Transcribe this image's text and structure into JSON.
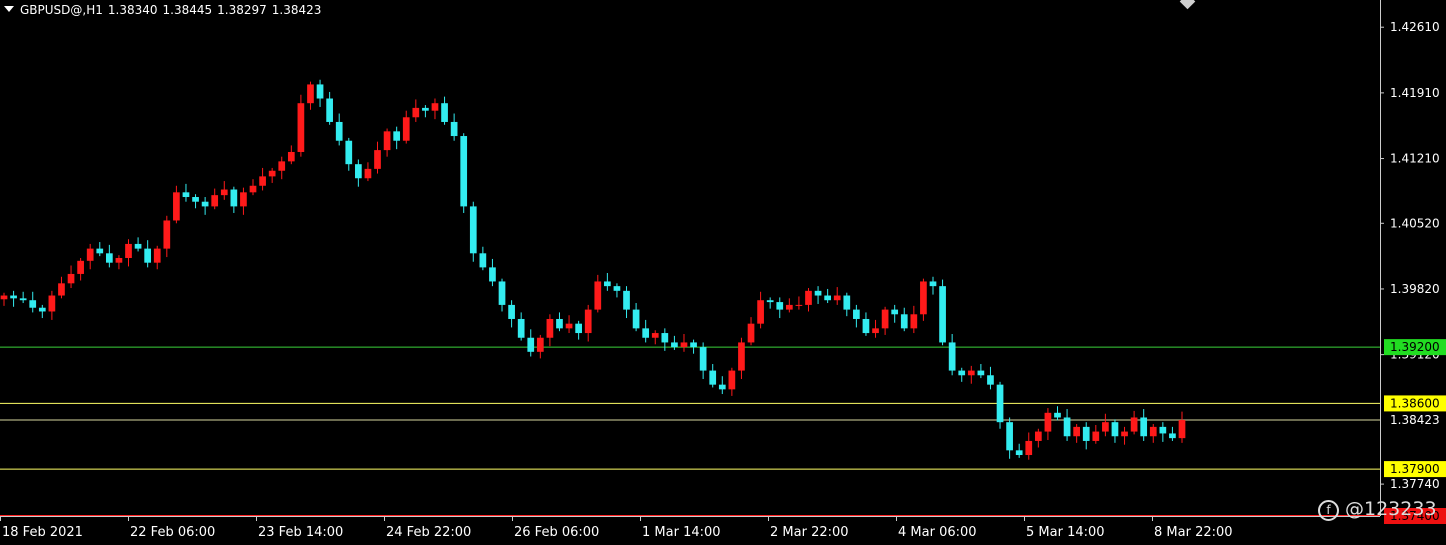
{
  "header": {
    "symbol_timeframe": "GBPUSD@,H1",
    "open": "1.38340",
    "high": "1.38445",
    "low": "1.38297",
    "close": "1.38423"
  },
  "watermark": {
    "logo_glyph": "f",
    "text": "@123233"
  },
  "colors": {
    "background": "#000000",
    "bull": "#ff1a1a",
    "bear": "#33ecf0",
    "level_green": "#3ad13a",
    "level_yellow": "#ffff66",
    "level_red": "#ff2020",
    "axis_text": "#ffffff",
    "grid_line": "#555555"
  },
  "chart_data": {
    "type": "candlestick",
    "title": "GBPUSD@,H1",
    "ylim": [
      1.374,
      1.429
    ],
    "y_ticks": [
      "1.42610",
      "1.41910",
      "1.41210",
      "1.40520",
      "1.39820",
      "1.39120",
      "1.37740"
    ],
    "x_ticks": [
      "18 Feb 2021",
      "22 Feb 06:00",
      "23 Feb 14:00",
      "24 Feb 22:00",
      "26 Feb 06:00",
      "1 Mar 14:00",
      "2 Mar 22:00",
      "4 Mar 06:00",
      "5 Mar 14:00",
      "8 Mar 22:00"
    ],
    "levels": [
      {
        "label": "1.39200",
        "value": 1.392,
        "color": "#3ad13a"
      },
      {
        "label": "1.38600",
        "value": 1.386,
        "color": "#ffff66"
      },
      {
        "label": "1.38423",
        "value": 1.38423,
        "color": "#d8d8a0",
        "current": true
      },
      {
        "label": "1.37900",
        "value": 1.379,
        "color": "#ffff66"
      },
      {
        "label": "1.37400",
        "value": 1.374,
        "color": "#ff2020"
      }
    ],
    "series": [
      {
        "name": "close",
        "values": [
          1.3975,
          1.3972,
          1.397,
          1.3962,
          1.3958,
          1.3975,
          1.3988,
          1.3998,
          1.4012,
          1.4025,
          1.402,
          1.401,
          1.4015,
          1.403,
          1.4025,
          1.401,
          1.4025,
          1.4055,
          1.4085,
          1.408,
          1.4075,
          1.407,
          1.4082,
          1.4088,
          1.407,
          1.4085,
          1.4092,
          1.4102,
          1.4108,
          1.4118,
          1.4128,
          1.418,
          1.42,
          1.4185,
          1.416,
          1.414,
          1.4115,
          1.41,
          1.411,
          1.413,
          1.415,
          1.414,
          1.4165,
          1.4175,
          1.4172,
          1.418,
          1.416,
          1.4145,
          1.407,
          1.402,
          1.4005,
          1.399,
          1.3965,
          1.395,
          1.393,
          1.3915,
          1.393,
          1.395,
          1.394,
          1.3945,
          1.3935,
          1.396,
          1.399,
          1.3985,
          1.398,
          1.396,
          1.394,
          1.393,
          1.3935,
          1.3925,
          1.392,
          1.3925,
          1.392,
          1.3895,
          1.388,
          1.3875,
          1.3895,
          1.3925,
          1.3945,
          1.397,
          1.3968,
          1.396,
          1.3965,
          1.3965,
          1.398,
          1.3975,
          1.397,
          1.3975,
          1.396,
          1.395,
          1.3935,
          1.394,
          1.396,
          1.3955,
          1.394,
          1.3955,
          1.399,
          1.3985,
          1.3925,
          1.3895,
          1.389,
          1.3895,
          1.389,
          1.388,
          1.384,
          1.381,
          1.3805,
          1.382,
          1.383,
          1.385,
          1.3845,
          1.3825,
          1.3835,
          1.382,
          1.383,
          1.384,
          1.3825,
          1.383,
          1.3845,
          1.3825,
          1.3835,
          1.3828,
          1.3823,
          1.38423
        ]
      }
    ]
  }
}
